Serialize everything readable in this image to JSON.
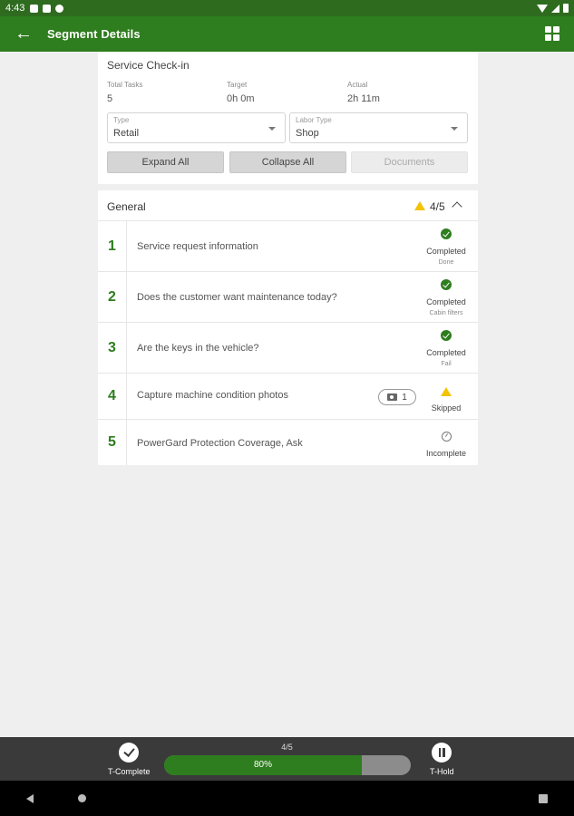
{
  "status_bar": {
    "time": "4:43"
  },
  "app_bar": {
    "title": "Segment Details"
  },
  "check_in": {
    "title": "Service Check-in",
    "stats": [
      {
        "label": "Total Tasks",
        "value": "5"
      },
      {
        "label": "Target",
        "value": "0h 0m"
      },
      {
        "label": "Actual",
        "value": "2h 11m"
      }
    ],
    "type_select": {
      "label": "Type",
      "value": "Retail"
    },
    "labor_select": {
      "label": "Labor Type",
      "value": "Shop"
    },
    "buttons": {
      "expand": "Expand All",
      "collapse": "Collapse All",
      "documents": "Documents"
    }
  },
  "section": {
    "title": "General",
    "count": "4/5",
    "tasks": [
      {
        "num": "1",
        "text": "Service request information",
        "status": "Completed",
        "sub": "Done"
      },
      {
        "num": "2",
        "text": "Does the customer want maintenance today?",
        "status": "Completed",
        "sub": "Cabin filters"
      },
      {
        "num": "3",
        "text": "Are the keys in the vehicle?",
        "status": "Completed",
        "sub": "Fail"
      },
      {
        "num": "4",
        "text": "Capture machine condition photos",
        "status": "Skipped",
        "photo_count": "1"
      },
      {
        "num": "5",
        "text": "PowerGard Protection Coverage, Ask",
        "status": "Incomplete"
      }
    ]
  },
  "action_bar": {
    "complete_label": "T-Complete",
    "hold_label": "T-Hold",
    "progress_fraction": "4/5",
    "progress_percent": "80%",
    "progress_value": 0.8
  },
  "colors": {
    "primary": "#2e7d1e",
    "warning": "#f3c300"
  }
}
